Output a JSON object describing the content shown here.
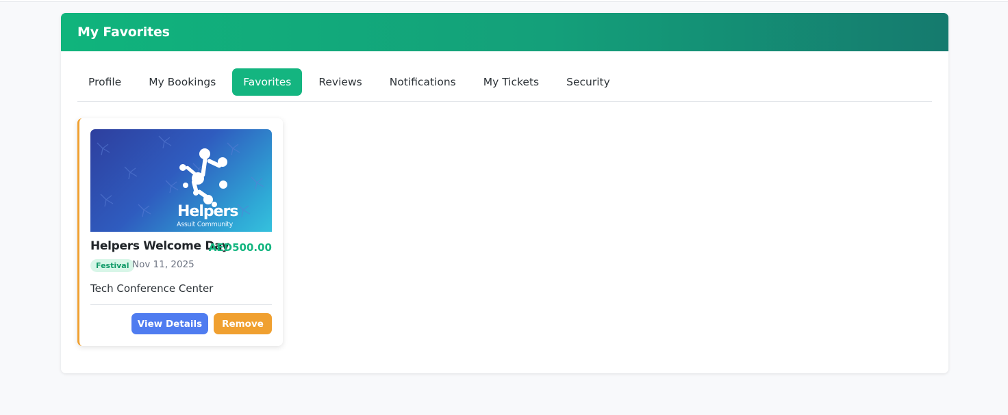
{
  "header": {
    "title": "My Favorites"
  },
  "tabs": [
    {
      "label": "Profile",
      "active": false
    },
    {
      "label": "My Bookings",
      "active": false
    },
    {
      "label": "Favorites",
      "active": true
    },
    {
      "label": "Reviews",
      "active": false
    },
    {
      "label": "Notifications",
      "active": false
    },
    {
      "label": "My Tickets",
      "active": false
    },
    {
      "label": "Security",
      "active": false
    }
  ],
  "favorites": [
    {
      "image": {
        "brand": "Helpers",
        "tagline": "Assuit Community",
        "icon": "molecule-logo-icon"
      },
      "title": "Helpers Welcome Day",
      "price": "AED500.00",
      "category": "Festival",
      "date": "Nov 11, 2025",
      "venue": "Tech Conference Center",
      "actions": {
        "view": "View Details",
        "remove": "Remove"
      }
    }
  ],
  "colors": {
    "header_gradient_start": "#10b47c",
    "header_gradient_end": "#157a6e",
    "active_tab": "#14b580",
    "price": "#14b580",
    "view_button": "#4f7cf0",
    "remove_button": "#f0a030",
    "card_accent": "#f0a030"
  }
}
